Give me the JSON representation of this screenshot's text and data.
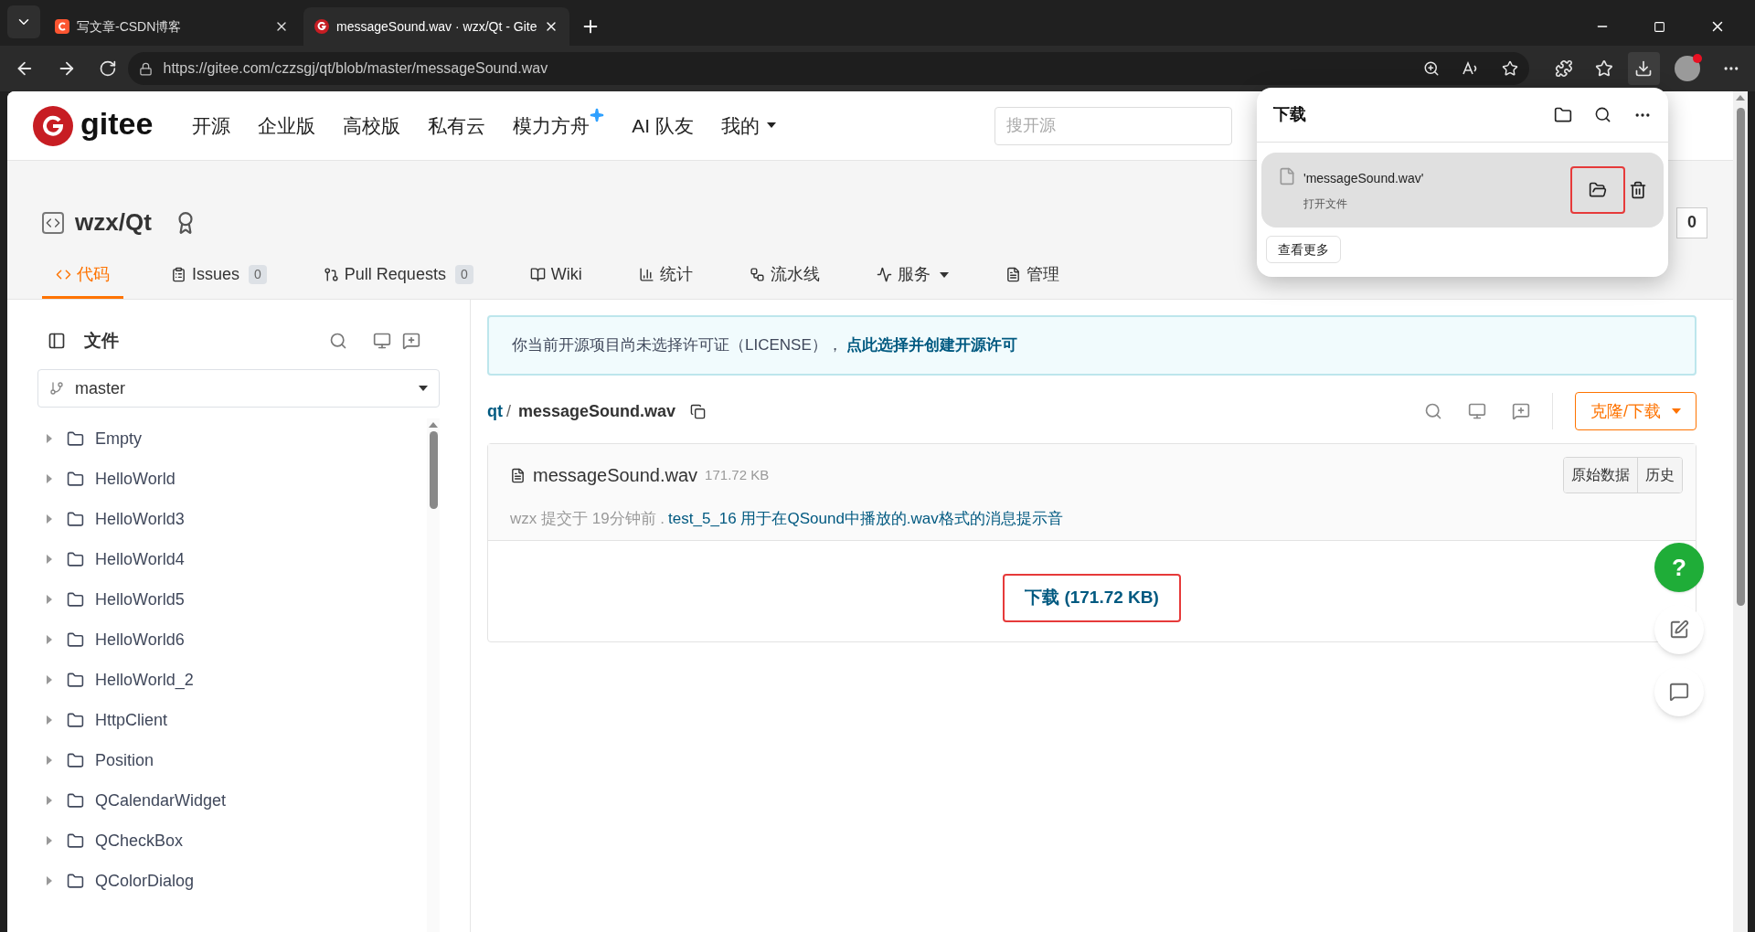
{
  "browser": {
    "tabs": [
      {
        "title": "写文章-CSDN博客",
        "kind": "csdn",
        "selected": false
      },
      {
        "title": "messageSound.wav · wzx/Qt - Gite",
        "kind": "gitee",
        "selected": true
      }
    ],
    "url": "https://gitee.com/czzsgj/qt/blob/master/messageSound.wav"
  },
  "header": {
    "logo": "gitee",
    "nav": [
      {
        "label": "开源",
        "sparkle": false,
        "dropdown": false
      },
      {
        "label": "企业版",
        "sparkle": false,
        "dropdown": false
      },
      {
        "label": "高校版",
        "sparkle": false,
        "dropdown": false
      },
      {
        "label": "私有云",
        "sparkle": false,
        "dropdown": false
      },
      {
        "label": "模力方舟",
        "sparkle": true,
        "dropdown": false
      },
      {
        "label": "AI 队友",
        "sparkle": false,
        "dropdown": false
      },
      {
        "label": "我的",
        "sparkle": false,
        "dropdown": true
      }
    ],
    "search_placeholder": "搜开源"
  },
  "repo": {
    "title": "wzx/Qt",
    "fork_count": "0",
    "tabs": [
      {
        "label": "代码",
        "selected": true
      },
      {
        "label": "Issues",
        "count": "0",
        "selected": false
      },
      {
        "label": "Pull Requests",
        "count": "0",
        "selected": false
      },
      {
        "label": "Wiki",
        "selected": false
      },
      {
        "label": "统计",
        "selected": false
      },
      {
        "label": "流水线",
        "selected": false
      },
      {
        "label": "服务",
        "dropdown": true,
        "selected": false
      },
      {
        "label": "管理",
        "selected": false
      }
    ]
  },
  "sidebar": {
    "title": "文件",
    "branch": "master",
    "items": [
      {
        "name": "Empty"
      },
      {
        "name": "HelloWorld"
      },
      {
        "name": "HelloWorld3"
      },
      {
        "name": "HelloWorld4"
      },
      {
        "name": "HelloWorld5"
      },
      {
        "name": "HelloWorld6"
      },
      {
        "name": "HelloWorld_2"
      },
      {
        "name": "HttpClient"
      },
      {
        "name": "Position"
      },
      {
        "name": "QCalendarWidget"
      },
      {
        "name": "QCheckBox"
      },
      {
        "name": "QColorDialog"
      }
    ]
  },
  "notice": {
    "text": "你当前开源项目尚未选择许可证（LICENSE），",
    "link": "点此选择并创建开源许可"
  },
  "breadcrumb": {
    "root": "qt",
    "separator": "/",
    "file": "messageSound.wav"
  },
  "clone_button": "克隆/下载",
  "file": {
    "name": "messageSound.wav",
    "size": "171.72 KB",
    "buttons": [
      "原始数据",
      "历史"
    ],
    "commit_info": "wzx 提交于 19分钟前 .",
    "commit_message": "test_5_16 用于在QSound中播放的.wav格式的消息提示音",
    "download": {
      "label": "下载 (171.72 KB)",
      "highlighted": true
    }
  },
  "download_panel": {
    "title": "下载",
    "items": [
      {
        "name": "'messageSound.wav'",
        "action": "打开文件",
        "folder_highlighted": true
      }
    ],
    "more": "查看更多"
  },
  "help_button": "?"
}
